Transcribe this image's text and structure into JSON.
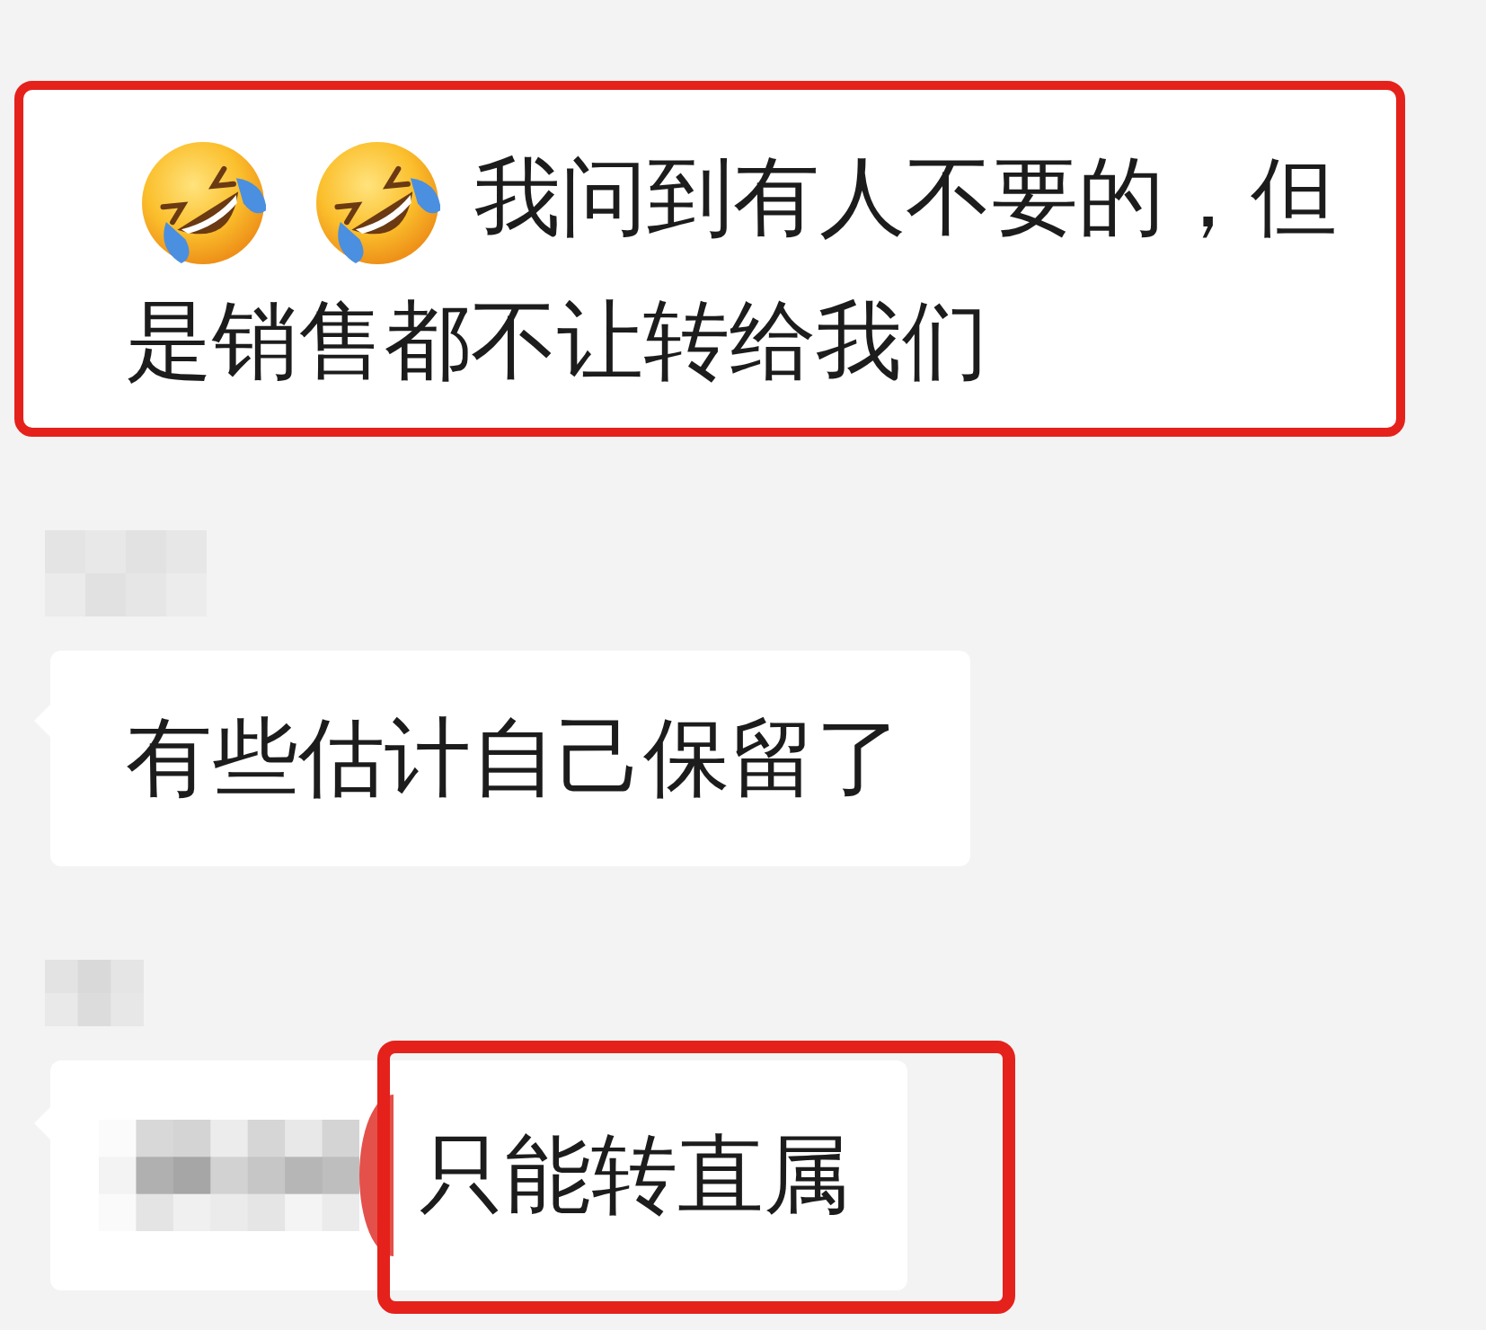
{
  "messages": [
    {
      "highlighted": true,
      "lines": [
        [
          {
            "kind": "emoji"
          },
          {
            "kind": "emoji"
          },
          {
            "kind": "text",
            "text": "我问到有人不要的，但",
            "highlighted": false
          }
        ],
        [
          {
            "kind": "text",
            "text": "是销售都不让转给我们",
            "highlighted": false
          }
        ]
      ]
    },
    {
      "highlighted": false,
      "sender": {
        "kind": "wide"
      },
      "lines": [
        [
          {
            "kind": "text",
            "text": "有些估计自己保留了",
            "highlighted": false
          }
        ]
      ]
    },
    {
      "highlighted": false,
      "sender": {
        "kind": "narrow"
      },
      "lines": [
        [
          {
            "kind": "pixelated"
          },
          {
            "kind": "marker"
          },
          {
            "kind": "text",
            "text": "只能转直属",
            "highlighted": true
          }
        ]
      ]
    }
  ]
}
